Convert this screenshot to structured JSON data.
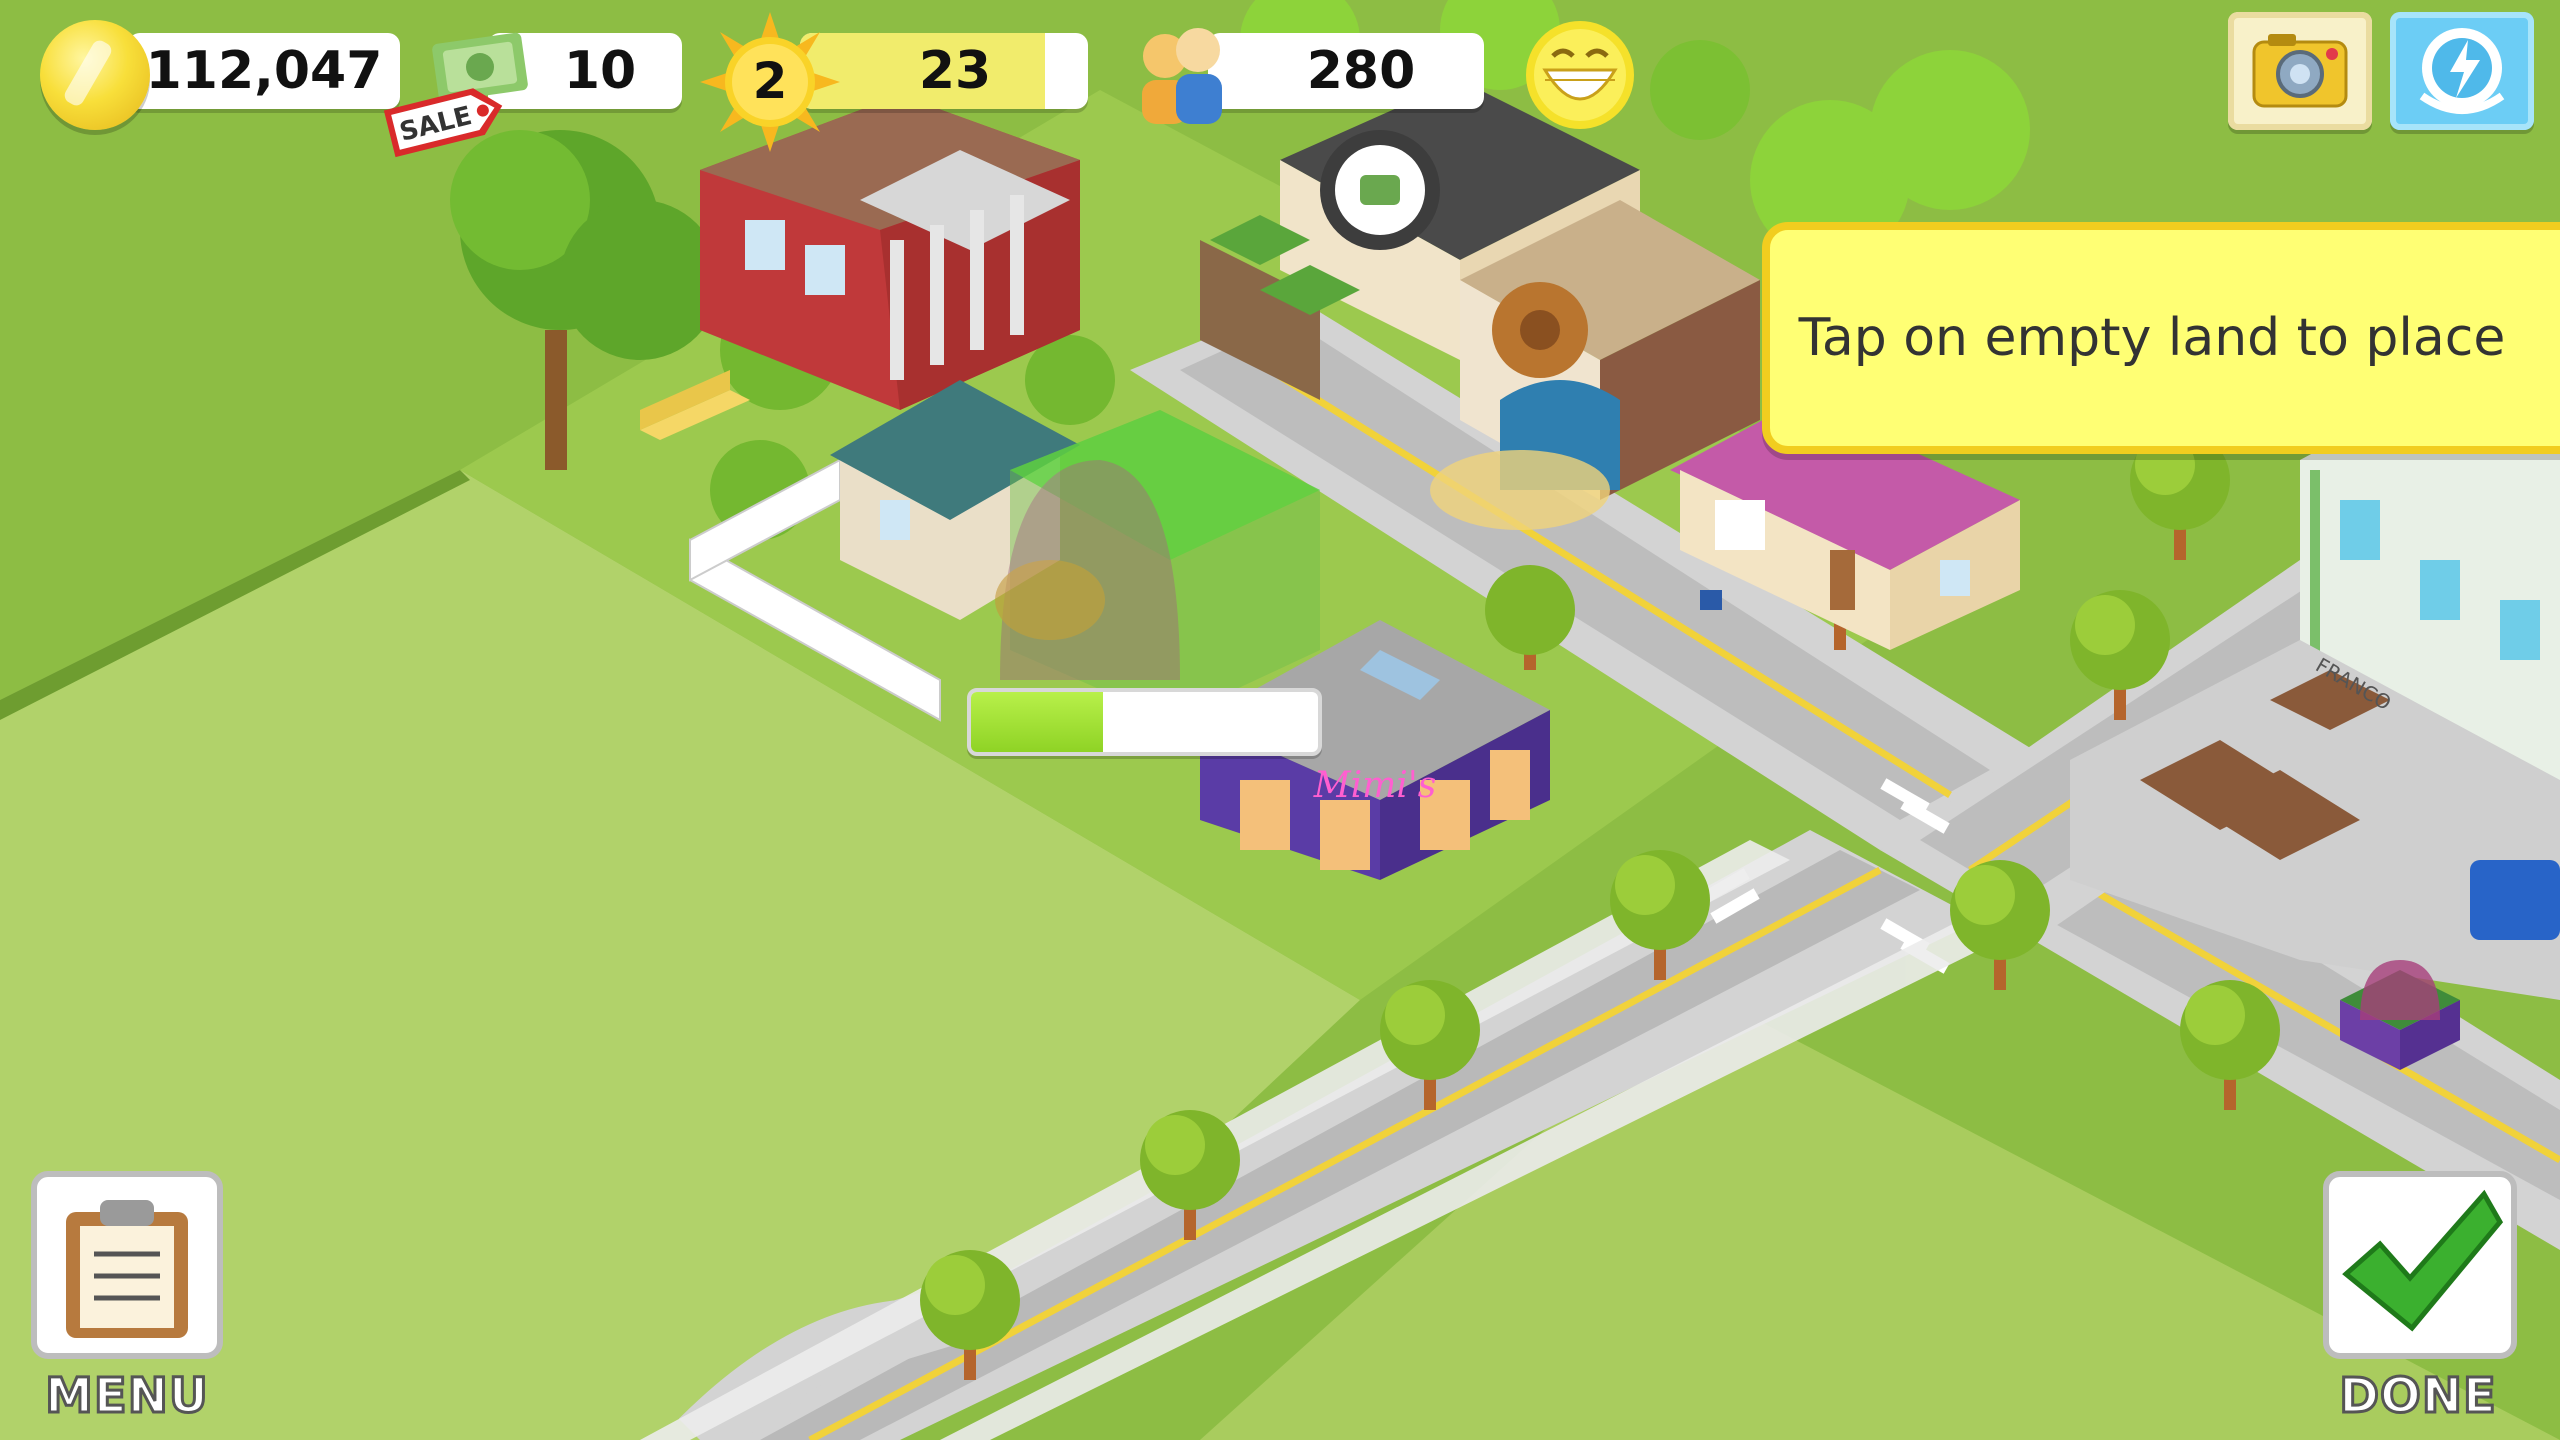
{
  "hud": {
    "coins": "112,047",
    "cash": "10",
    "sale_label": "SALE",
    "level": "2",
    "xp": "23",
    "xp_fill_fraction": 0.85,
    "population": "280",
    "happiness_icon": "smiley-face-icon",
    "camera_icon": "camera-icon",
    "social_icon": "social-share-icon"
  },
  "tooltip": {
    "text": "Tap on empty land to place"
  },
  "building": {
    "shop_sign": "Mimi's",
    "warehouse_sign": "FRANCO",
    "construction_progress": 0.38
  },
  "buttons": {
    "menu_label": "MENU",
    "done_label": "DONE"
  },
  "colors": {
    "grass_dark": "#8fbf45",
    "grass_light": "#b3d46d",
    "road": "#cfcfcf",
    "road_line": "#f1d23a",
    "tooltip_bg": "#ffff74",
    "progress_fill": "#9ddc2e"
  }
}
